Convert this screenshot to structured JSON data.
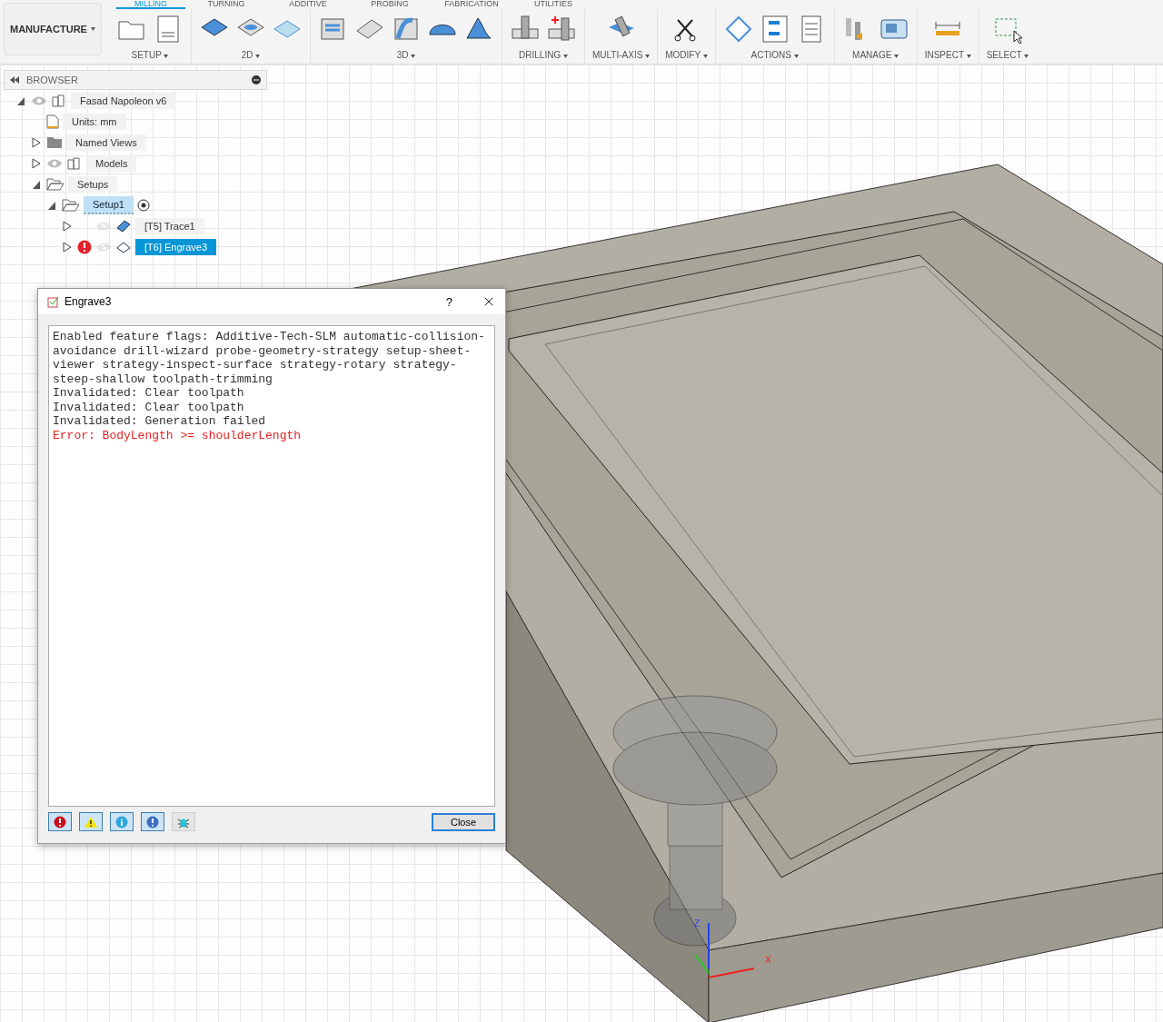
{
  "workspace": {
    "label": "MANUFACTURE"
  },
  "tabs": [
    {
      "label": "MILLING",
      "selected": true
    },
    {
      "label": "TURNING",
      "selected": false
    },
    {
      "label": "ADDITIVE",
      "selected": false
    },
    {
      "label": "PROBING",
      "selected": false
    },
    {
      "label": "FABRICATION",
      "selected": false
    },
    {
      "label": "UTILITIES",
      "selected": false
    }
  ],
  "toolbar_groups": [
    {
      "label": "SETUP",
      "kind": "setup"
    },
    {
      "label": "2D",
      "kind": "twod"
    },
    {
      "label": "3D",
      "kind": "threed"
    },
    {
      "label": "DRILLING",
      "kind": "drilling"
    },
    {
      "label": "MULTI-AXIS",
      "kind": "multiaxis"
    },
    {
      "label": "MODIFY",
      "kind": "modify"
    },
    {
      "label": "ACTIONS",
      "kind": "actions"
    },
    {
      "label": "MANAGE",
      "kind": "manage"
    },
    {
      "label": "INSPECT",
      "kind": "inspect"
    },
    {
      "label": "SELECT",
      "kind": "select"
    }
  ],
  "browser": {
    "title": "BROWSER",
    "tree": [
      {
        "label": "Fasad Napoleon v6",
        "kind": "component",
        "expanded": true,
        "visible": true,
        "selected": false,
        "children": [
          {
            "label": "Units: mm",
            "kind": "units",
            "selected": false
          },
          {
            "label": "Named Views",
            "kind": "folder",
            "expanded": false,
            "selected": false
          },
          {
            "label": "Models",
            "kind": "component",
            "expanded": false,
            "visible": true,
            "selected": false
          },
          {
            "label": "Setups",
            "kind": "setups",
            "expanded": true,
            "selected": false,
            "children": [
              {
                "label": "Setup1",
                "kind": "setup",
                "expanded": true,
                "active": true,
                "selected": false,
                "children": [
                  {
                    "label": "[T5] Trace1",
                    "kind": "trace",
                    "expanded": false,
                    "visible": false,
                    "error": false,
                    "selected": false
                  },
                  {
                    "label": "[T6] Engrave3",
                    "kind": "engrave",
                    "expanded": false,
                    "visible": false,
                    "error": true,
                    "selected": true
                  }
                ]
              }
            ]
          }
        ]
      }
    ]
  },
  "dialog": {
    "title": "Engrave3",
    "help": "?",
    "log": [
      {
        "kind": "info",
        "text": "Enabled feature flags: Additive-Tech-SLM automatic-collision-avoidance drill-wizard probe-geometry-strategy setup-sheet-viewer strategy-inspect-surface strategy-rotary strategy-steep-shallow toolpath-trimming"
      },
      {
        "kind": "info",
        "text": "Invalidated: Clear toolpath"
      },
      {
        "kind": "info",
        "text": "Invalidated: Clear toolpath"
      },
      {
        "kind": "info",
        "text": "Invalidated: Generation failed"
      },
      {
        "kind": "error",
        "text": "Error: BodyLength >= shoulderLength"
      }
    ],
    "filters": [
      {
        "kind": "error",
        "on": true
      },
      {
        "kind": "warning",
        "on": true
      },
      {
        "kind": "info",
        "on": true
      },
      {
        "kind": "important",
        "on": true
      },
      {
        "kind": "debug",
        "on": false
      }
    ],
    "close_button": "Close"
  },
  "view_axes": {
    "z": "Z",
    "x": "X"
  }
}
